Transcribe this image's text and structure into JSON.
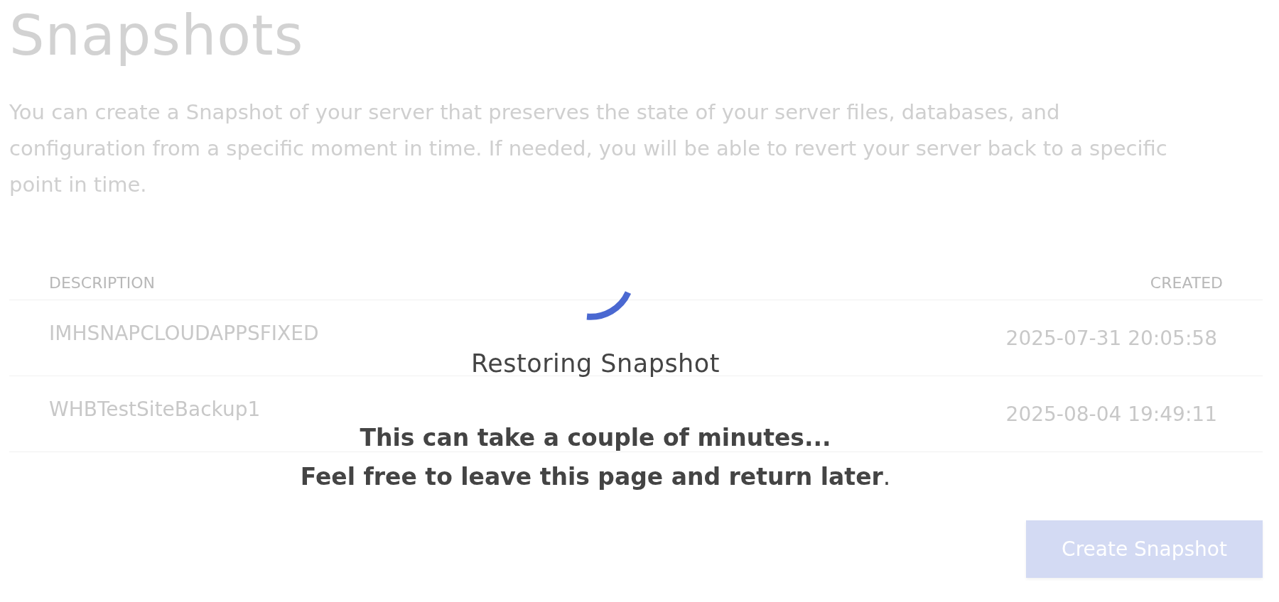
{
  "page": {
    "title": "Snapshots",
    "description": "You can create a Snapshot of your server that preserves the state of your server files, databases, and configuration from a specific moment in time. If needed, you will be able to revert your server back to a specific point in time."
  },
  "table": {
    "columns": [
      "DESCRIPTION",
      "CREATED"
    ],
    "rows": [
      {
        "description": "IMHSNAPCLOUDAPPSFIXED",
        "created": "2025-07-31 20:05:58"
      },
      {
        "description": "WHBTestSiteBackup1",
        "created": "2025-08-04 19:49:11"
      }
    ]
  },
  "create_button": {
    "label": "Create Snapshot"
  },
  "overlay": {
    "title": "Restoring Snapshot",
    "lines": [
      "This can take a couple of minutes...",
      "**Feel free to leave this page and return later**."
    ]
  }
}
